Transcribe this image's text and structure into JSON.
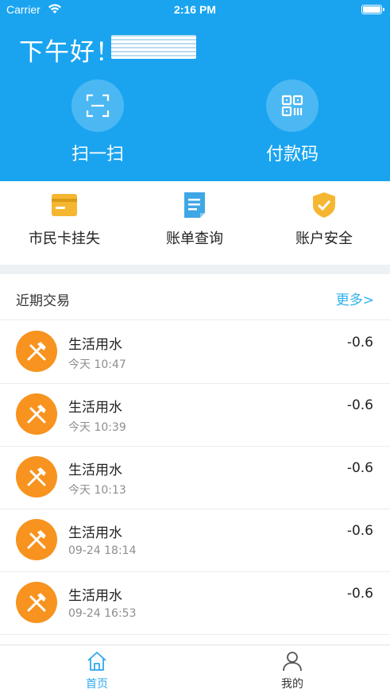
{
  "status_bar": {
    "carrier": "Carrier",
    "time": "2:16 PM"
  },
  "header": {
    "greeting": "下午好！",
    "actions": [
      {
        "label": "扫一扫",
        "icon": "scan-icon"
      },
      {
        "label": "付款码",
        "icon": "qr-code-icon"
      }
    ]
  },
  "quick_actions": [
    {
      "label": "市民卡挂失",
      "icon": "card-icon",
      "color": "#f5b731"
    },
    {
      "label": "账单查询",
      "icon": "document-icon",
      "color": "#3ea7e6"
    },
    {
      "label": "账户安全",
      "icon": "shield-check-icon",
      "color": "#f5b731"
    }
  ],
  "recent": {
    "title": "近期交易",
    "more": "更多>",
    "transactions": [
      {
        "name": "生活用水",
        "time": "今天 10:47",
        "amount": "-0.6"
      },
      {
        "name": "生活用水",
        "time": "今天 10:39",
        "amount": "-0.6"
      },
      {
        "name": "生活用水",
        "time": "今天 10:13",
        "amount": "-0.6"
      },
      {
        "name": "生活用水",
        "time": "09-24 18:14",
        "amount": "-0.6"
      },
      {
        "name": "生活用水",
        "time": "09-24 16:53",
        "amount": "-0.6"
      }
    ]
  },
  "tabbar": {
    "home": "首页",
    "me": "我的"
  },
  "colors": {
    "primary": "#1aa4f0",
    "accent": "#f7931e",
    "link": "#2fb2ee"
  }
}
